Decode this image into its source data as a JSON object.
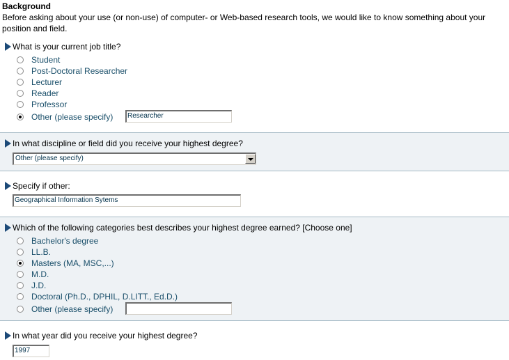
{
  "background": {
    "title": "Background",
    "description": "Before asking about your use (or non-use) of computer- or Web-based research tools, we would like to know something about your position and field."
  },
  "q_job_title": {
    "question": "What is your current job title?",
    "options": [
      {
        "label": "Student",
        "checked": false
      },
      {
        "label": "Post-Doctoral Researcher",
        "checked": false
      },
      {
        "label": "Lecturer",
        "checked": false
      },
      {
        "label": "Reader",
        "checked": false
      },
      {
        "label": "Professor",
        "checked": false
      },
      {
        "label": "Other (please specify)",
        "checked": true
      }
    ],
    "other_value": "Researcher"
  },
  "q_discipline": {
    "question": "In what discipline or field did you receive your highest degree?",
    "selected": "Other (please specify)"
  },
  "q_specify_other": {
    "question": "Specify if other:",
    "value": "Geographical Information Sytems"
  },
  "q_degree": {
    "question": "Which of the following categories best describes your highest degree earned? [Choose one]",
    "options": [
      {
        "label": "Bachelor's degree",
        "checked": false
      },
      {
        "label": "LL.B.",
        "checked": false
      },
      {
        "label": "Masters (MA, MSC,...)",
        "checked": true
      },
      {
        "label": "M.D.",
        "checked": false
      },
      {
        "label": "J.D.",
        "checked": false
      },
      {
        "label": "Doctoral (Ph.D., DPHIL, D.LITT., Ed.D.)",
        "checked": false
      },
      {
        "label": "Other (please specify)",
        "checked": false
      }
    ],
    "other_value": ""
  },
  "q_year": {
    "question": "In what year did you receive your highest degree?",
    "value": "1997"
  }
}
